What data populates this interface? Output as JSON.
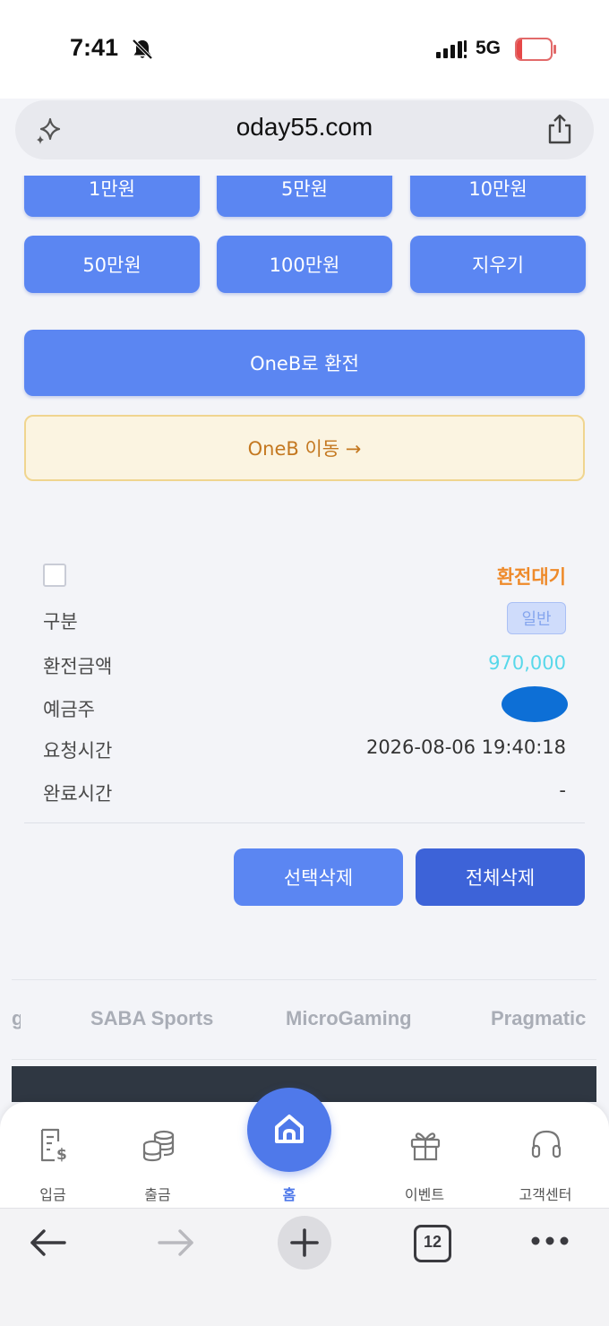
{
  "status_bar": {
    "time": "7:41",
    "network": "5G",
    "battery": "17",
    "battery_level": 0.17
  },
  "browser": {
    "url": "oday55.com",
    "tabs_count": "12"
  },
  "amount_buttons": [
    "1만원",
    "5만원",
    "10만원",
    "50만원",
    "100만원",
    "지우기"
  ],
  "actions": {
    "convert_label": "OneB로 환전",
    "move_label": "OneB 이동 →"
  },
  "record": {
    "status": "환전대기",
    "category_label": "구분",
    "category_badge": "일반",
    "amount_label": "환전금액",
    "amount_value": "970,000",
    "depositor_label": "예금주",
    "request_time_label": "요청시간",
    "request_time_value": "2026-08-06 19:40:18",
    "complete_time_label": "완료시간",
    "complete_time_value": "-"
  },
  "delete_buttons": {
    "selected": "선택삭제",
    "all": "전체삭제"
  },
  "providers": [
    "g",
    "SABA Sports",
    "MicroGaming",
    "Pragmatic"
  ],
  "bottom_nav": {
    "deposit": "입금",
    "withdraw": "출금",
    "home": "홈",
    "event": "이벤트",
    "support": "고객센터"
  },
  "colors": {
    "primary": "#5b86f2",
    "primary_dark": "#3d63d8",
    "status_orange": "#ee8a2a",
    "amount_cyan": "#58d8ea",
    "move_bg": "#fbf4e1"
  }
}
